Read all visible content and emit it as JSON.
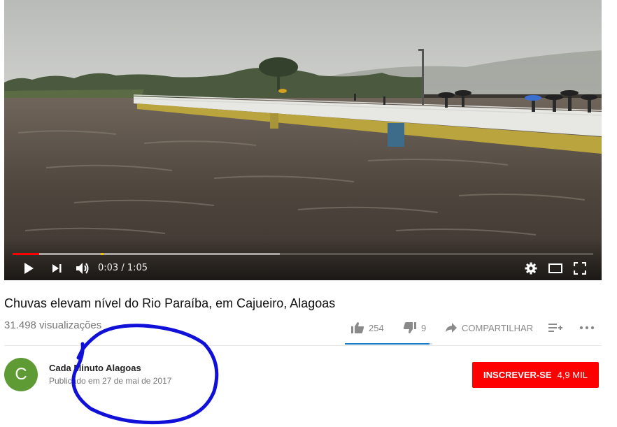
{
  "player": {
    "current_time": "0:03",
    "time_separator": " / ",
    "duration": "1:05",
    "played_fraction": 0.046,
    "buffered_fraction": 0.46,
    "colors": {
      "progress_played": "#ff0000",
      "marker": "#f2c300"
    },
    "icons": [
      "play-icon",
      "next-icon",
      "volume-icon",
      "settings-gear-icon",
      "theater-mode-icon",
      "fullscreen-icon"
    ]
  },
  "video": {
    "title": "Chuvas elevam nível do Rio Paraíba, em Cajueiro, Alagoas",
    "views": "31.498 visualizações"
  },
  "actions": {
    "likes": "254",
    "dislikes": "9",
    "share_label": "COMPARTILHAR",
    "like_fraction": 0.966
  },
  "channel": {
    "avatar_letter": "C",
    "name": "Cada Minuto Alagoas",
    "published": "Publicado em 27 de mai de 2017",
    "colors": {
      "avatar": "#5f9b34"
    }
  },
  "subscribe": {
    "label": "INSCREVER-SE",
    "count": "4,9 MIL",
    "colors": {
      "button": "#ff0000"
    }
  },
  "annotation": {
    "color": "#1010d8",
    "shape": "hand-drawn circle around channel info"
  }
}
